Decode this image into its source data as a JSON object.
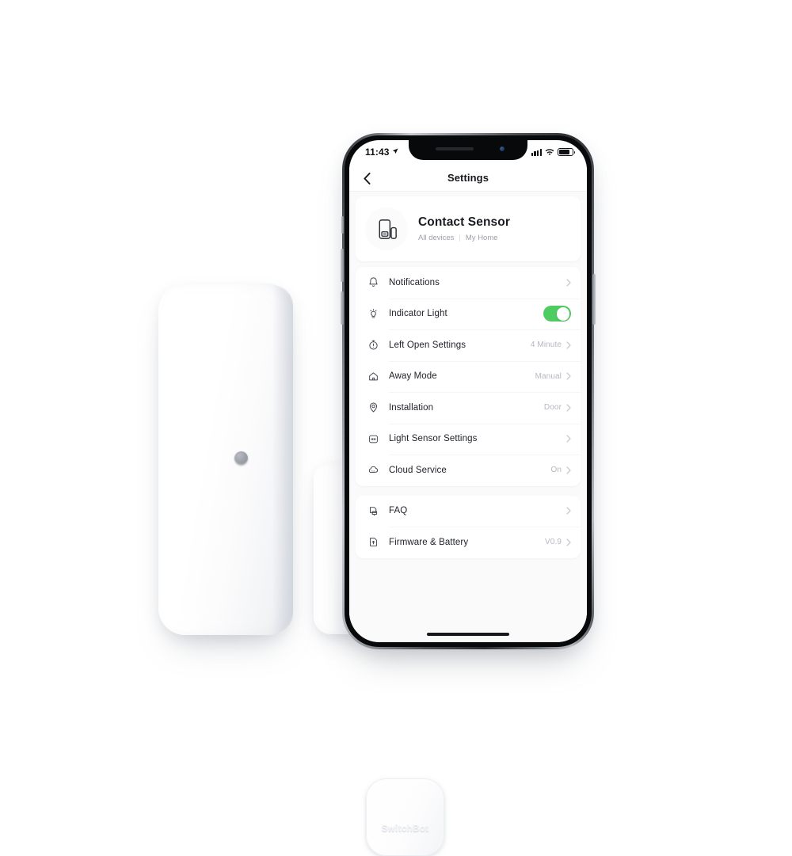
{
  "product": {
    "device_brand": "SwitchBot",
    "device_name": "Contact Sensor"
  },
  "phone": {
    "status_bar": {
      "time": "11:43",
      "location_icon": "location-arrow-icon",
      "signal_icon": "cellular-signal-icon",
      "wifi_icon": "wifi-icon",
      "battery_icon": "battery-icon"
    },
    "nav": {
      "back_icon": "chevron-left-icon",
      "title": "Settings"
    }
  },
  "device_card": {
    "icon": "contact-sensor-icon",
    "name": "Contact Sensor",
    "scope": "All devices",
    "separator": "|",
    "home": "My Home"
  },
  "settings_groups": [
    {
      "rows": [
        {
          "icon": "bell-icon",
          "label": "Notifications",
          "value": "",
          "control": "chevron"
        },
        {
          "icon": "lightbulb-icon",
          "label": "Indicator Light",
          "value": "",
          "control": "toggle",
          "toggle_on": true
        },
        {
          "icon": "stopwatch-icon",
          "label": "Left Open Settings",
          "value": "4 Minute",
          "control": "chevron"
        },
        {
          "icon": "house-icon",
          "label": "Away Mode",
          "value": "Manual",
          "control": "chevron"
        },
        {
          "icon": "location-pin-icon",
          "label": "Installation",
          "value": "Door",
          "control": "chevron"
        },
        {
          "icon": "light-sensor-icon",
          "label": "Light Sensor Settings",
          "value": "",
          "control": "chevron"
        },
        {
          "icon": "cloud-icon",
          "label": "Cloud Service",
          "value": "On",
          "control": "chevron"
        }
      ]
    },
    {
      "rows": [
        {
          "icon": "faq-icon",
          "label": "FAQ",
          "value": "",
          "control": "chevron"
        },
        {
          "icon": "firmware-icon",
          "label": "Firmware & Battery",
          "value": "V0.9",
          "control": "chevron"
        }
      ]
    }
  ],
  "colors": {
    "toggle_on": "#4ecc62",
    "text_primary": "#20232a",
    "text_muted": "#b4b8c0",
    "page_bg": "#fafafb"
  }
}
